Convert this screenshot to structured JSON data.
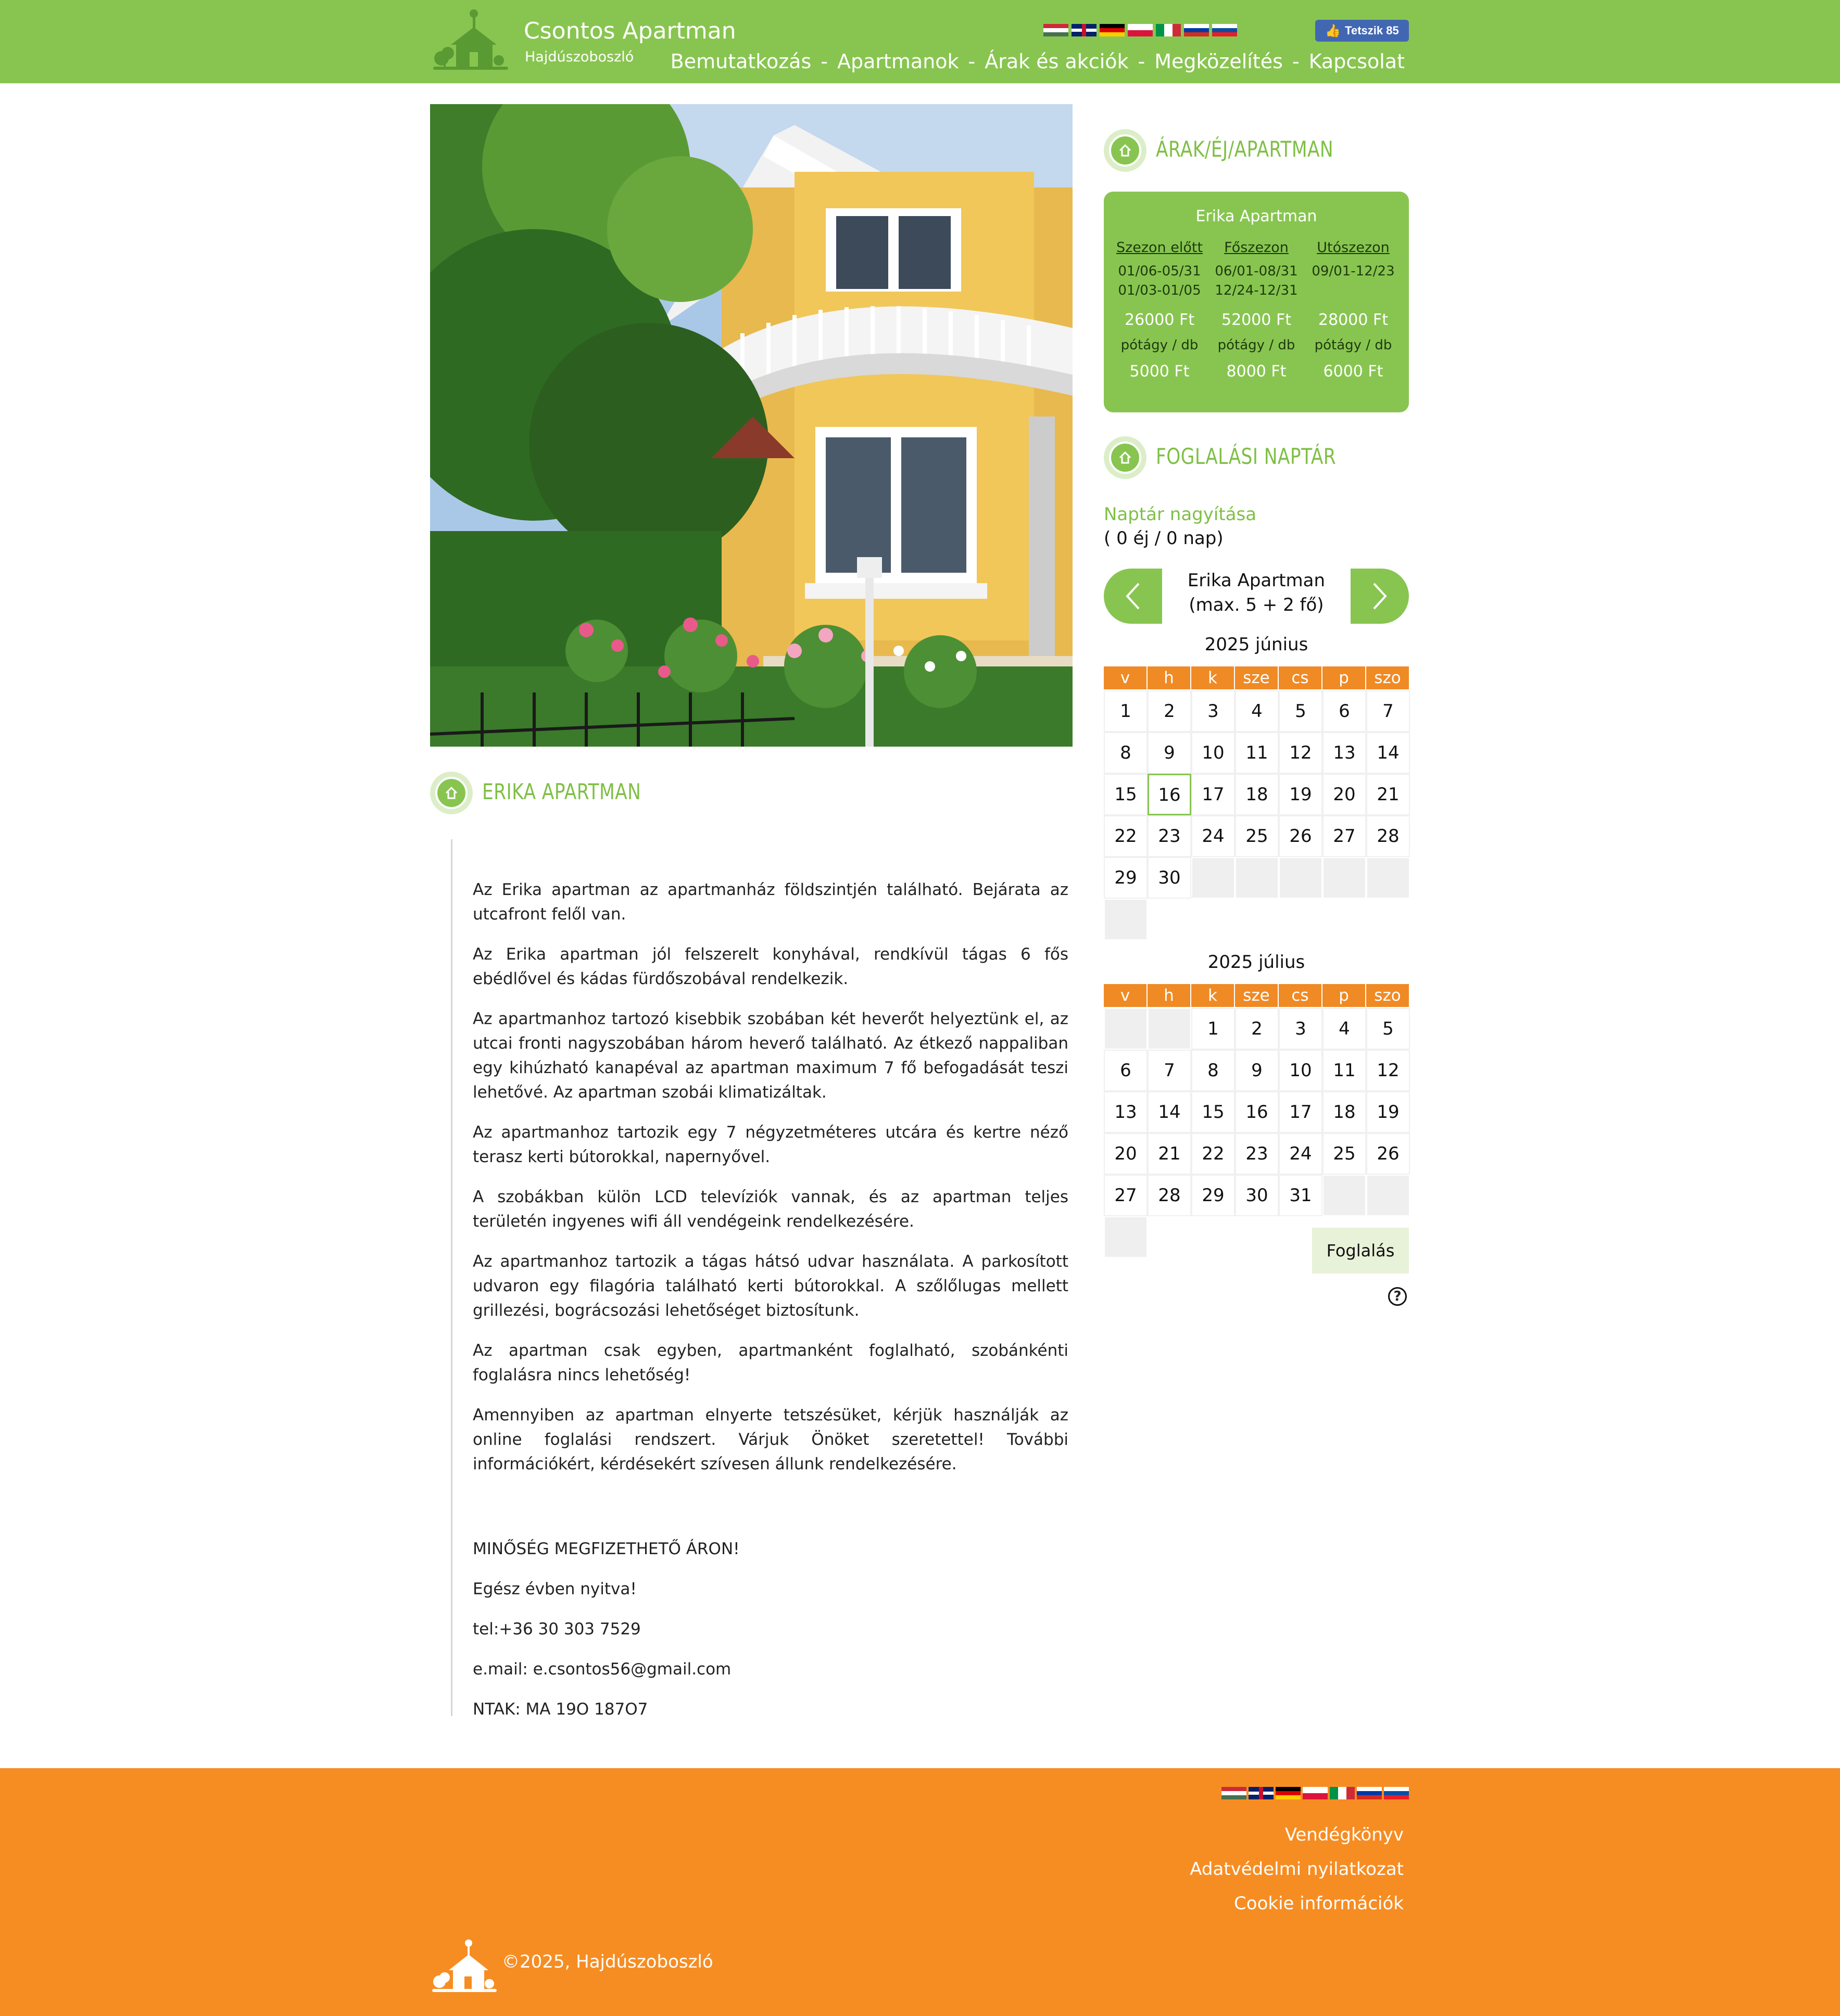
{
  "header": {
    "title": "Csontos Apartman",
    "subtitle": "Hajdúszoboszló",
    "like_label": "Tetszik 85",
    "nav": [
      "Bemutatkozás",
      "Apartmanok",
      "Árak és akciók",
      "Megközelítés",
      "Kapcsolat"
    ],
    "nav_separator": "-"
  },
  "languages": [
    "hungarian-flag",
    "english-flag",
    "german-flag",
    "polish-flag",
    "italian-flag",
    "russian-flag",
    "slovak-flag"
  ],
  "colors": {
    "green": "#88c550",
    "orange": "#f68d23",
    "calendar_header": "#f08a24"
  },
  "apartment": {
    "title": "ERIKA APARTMAN",
    "paragraphs": [
      "Az Erika apartman az apartmanház földszintjén található. Bejárata az utcafront felől van.",
      "Az Erika apartman jól felszerelt konyhával, rendkívül tágas 6 fős ebédlővel és kádas fürdőszobával rendelkezik.",
      "Az apartmanhoz tartozó kisebbik szobában két heverőt helyeztünk el, az utcai fronti nagyszobában három heverő található. Az étkező nappaliban egy kihúzható kanapéval az apartman maximum 7 fő befogadását teszi lehetővé. Az apartman szobái klimatizáltak.",
      "Az apartmanhoz tartozik egy 7 négyzetméteres utcára és kertre néző terasz kerti bútorokkal, napernyővel.",
      "A szobákban külön LCD televíziók vannak, és az apartman teljes területén ingyenes wifi áll vendégeink rendelkezésére.",
      "Az apartmanhoz tartozik a tágas hátsó udvar használata. A parkosított udvaron egy filagória található kerti bútorokkal. A szőlőlugas mellett grillezési, bográcsozási lehetőséget biztosítunk.",
      "Az apartman csak egyben, apartmanként foglalható, szobánkénti foglalásra nincs lehetőség!",
      "Amennyiben az apartman elnyerte tetszésüket, kérjük használják az online foglalási rendszert. Várjuk Önöket szeretettel! További információkért, kérdésekért szívesen állunk rendelkezésére."
    ],
    "slogan": "MINŐSÉG MEGFIZETHETŐ ÁRON!",
    "open": "Egész évben nyitva!",
    "phone": "tel:+36 30 303 7529",
    "email": "e.mail: e.csontos56@gmail.com",
    "ntak": "NTAK: MA 19O 187O7"
  },
  "prices": {
    "title": "ÁRAK/ÉJ/APARTMAN",
    "apartment": "Erika Apartman",
    "columns": [
      {
        "head": "Szezon előtt",
        "dates": [
          "01/06-05/31",
          "01/03-01/05"
        ],
        "price": "26000 Ft",
        "extra_label": "pótágy / db",
        "extra_price": "5000 Ft"
      },
      {
        "head": "Főszezon",
        "dates": [
          "06/01-08/31",
          "12/24-12/31"
        ],
        "price": "52000 Ft",
        "extra_label": "pótágy / db",
        "extra_price": "8000 Ft"
      },
      {
        "head": "Utószezon",
        "dates": [
          "09/01-12/23",
          ""
        ],
        "price": "28000 Ft",
        "extra_label": "pótágy / db",
        "extra_price": "6000 Ft"
      }
    ]
  },
  "booking": {
    "title": "FOGLALÁSI NAPTÁR",
    "enlarge": "Naptár nagyítása",
    "count": "( 0 éj / 0 nap)",
    "apartment_line1": "Erika Apartman",
    "apartment_line2": "(max. 5 + 2 fő)",
    "weekdays": [
      "v",
      "h",
      "k",
      "sze",
      "cs",
      "p",
      "szo"
    ],
    "months": [
      {
        "title": "2025 június",
        "lead_blanks": 0,
        "days": 30,
        "today": 16
      },
      {
        "title": "2025 július",
        "lead_blanks": 2,
        "days": 31,
        "today": null
      }
    ],
    "book_button": "Foglalás",
    "help": "?"
  },
  "footer": {
    "links": [
      "Vendégkönyv",
      "Adatvédelmi nyilatkozat",
      "Cookie információk"
    ],
    "copyright": "©2025, Hajdúszoboszló"
  }
}
